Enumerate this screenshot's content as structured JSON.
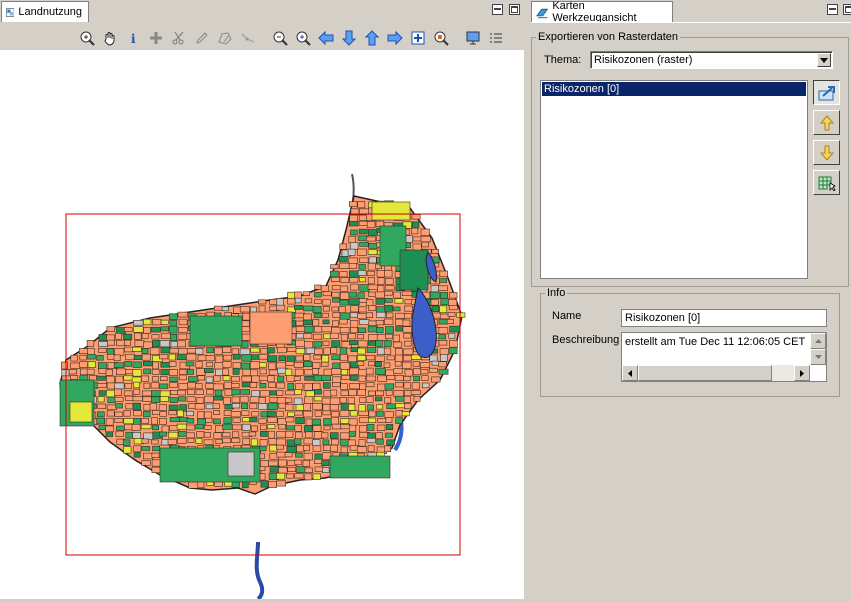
{
  "left_view": {
    "tab_label": "Landnutzung",
    "toolbar": [
      {
        "icon": "zoom-in-area-icon",
        "name": "zoom-area-tool"
      },
      {
        "icon": "pan-hand-icon",
        "name": "pan-tool"
      },
      {
        "icon": "info-icon",
        "name": "info-tool"
      },
      {
        "icon": "move-cross-icon",
        "name": "move-tool"
      },
      {
        "icon": "scissors-icon",
        "name": "split-tool"
      },
      {
        "icon": "pencil-icon",
        "name": "edit-tool"
      },
      {
        "icon": "polygon-edit-icon",
        "name": "polygon-tool"
      },
      {
        "icon": "line-edit-icon",
        "name": "line-tool"
      },
      {
        "icon": "zoom-out-icon",
        "name": "zoom-out-tool"
      },
      {
        "icon": "zoom-in-icon",
        "name": "zoom-in-tool"
      },
      {
        "icon": "arrow-left-icon",
        "name": "pan-left"
      },
      {
        "icon": "arrow-down-icon",
        "name": "pan-down"
      },
      {
        "icon": "arrow-up-icon",
        "name": "pan-up"
      },
      {
        "icon": "arrow-right-icon",
        "name": "pan-right"
      },
      {
        "icon": "full-extent-icon",
        "name": "full-extent"
      },
      {
        "icon": "zoom-selection-icon",
        "name": "zoom-selection"
      },
      {
        "icon": "monitor-icon",
        "name": "display-settings"
      },
      {
        "icon": "list-icon",
        "name": "legend-list"
      }
    ],
    "map": {
      "extent_frame_color": "#d40000",
      "land_colors": [
        "#fd9d72",
        "#30a860",
        "#e3e83a",
        "#c8c8c8",
        "#1e8f52",
        "#3b5ec8"
      ]
    }
  },
  "right_view": {
    "tab_label": "Karten Werkzeugansicht",
    "export_group": {
      "title": "Exportieren von Rasterdaten",
      "thema_label": "Thema:",
      "thema_value": "Risikozonen (raster)",
      "list_items": [
        "Risikozonen [0]"
      ],
      "buttons": [
        "export-icon",
        "arrow-up-icon",
        "arrow-down-icon",
        "grid-select-icon"
      ]
    },
    "info_group": {
      "title": "Info",
      "name_label": "Name",
      "name_value": "Risikozonen [0]",
      "beschreibung_label": "Beschreibung",
      "beschreibung_value": "erstellt am Tue Dec 11 12:06:05 CET"
    }
  }
}
